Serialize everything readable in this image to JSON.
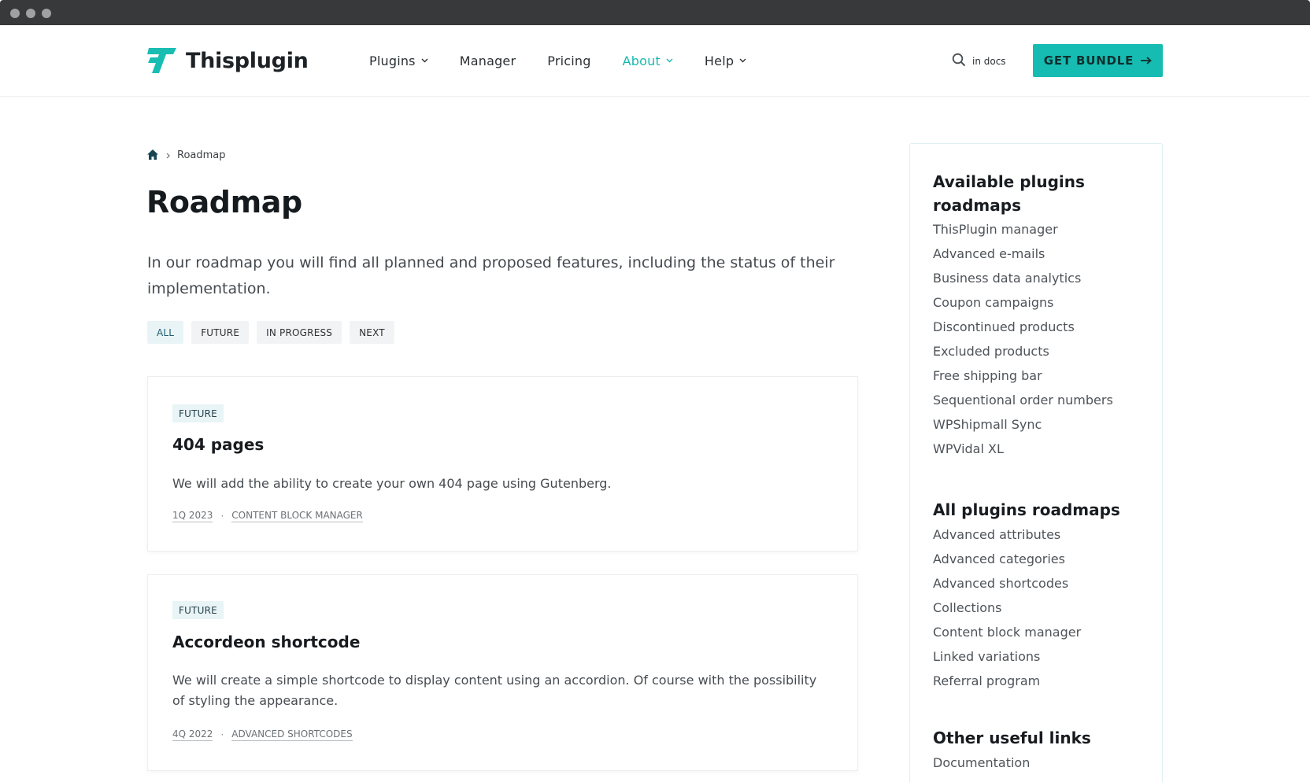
{
  "header": {
    "logo_text": "Thisplugin",
    "nav": [
      {
        "label": "Plugins",
        "dropdown": true,
        "active": false
      },
      {
        "label": "Manager",
        "dropdown": false,
        "active": false
      },
      {
        "label": "Pricing",
        "dropdown": false,
        "active": false
      },
      {
        "label": "About",
        "dropdown": true,
        "active": true
      },
      {
        "label": "Help",
        "dropdown": true,
        "active": false
      }
    ],
    "search_label": "in docs",
    "cta_label": "GET BUNDLE"
  },
  "breadcrumb": {
    "current": "Roadmap"
  },
  "main": {
    "title": "Roadmap",
    "intro": "In our roadmap you will find all planned and proposed features, including the status of their implementation.",
    "filters": [
      {
        "label": "ALL",
        "active": true
      },
      {
        "label": "FUTURE",
        "active": false
      },
      {
        "label": "IN PROGRESS",
        "active": false
      },
      {
        "label": "NEXT",
        "active": false
      }
    ],
    "cards": [
      {
        "badge": "FUTURE",
        "title": "404 pages",
        "description": "We will add the ability to create your own 404 page using Gutenberg.",
        "quarter": "1Q 2023",
        "plugin": "CONTENT BLOCK MANAGER"
      },
      {
        "badge": "FUTURE",
        "title": "Accordeon shortcode",
        "description": "We will create a simple shortcode to display content using an accordion. Of course with the possibility of styling the appearance.",
        "quarter": "4Q 2022",
        "plugin": "ADVANCED SHORTCODES"
      }
    ]
  },
  "sidebar": {
    "available_heading": "Available plugins roadmaps",
    "available": [
      "ThisPlugin manager",
      "Advanced e-mails",
      "Business data analytics",
      "Coupon campaigns",
      "Discontinued products",
      "Excluded products",
      "Free shipping bar",
      "Sequentional order numbers",
      "WPShipmall Sync",
      "WPVidal XL"
    ],
    "all_heading": "All plugins roadmaps",
    "all": [
      "Advanced attributes",
      "Advanced categories",
      "Advanced shortcodes",
      "Collections",
      "Content block manager",
      "Linked variations",
      "Referral program"
    ],
    "other_heading": "Other useful links",
    "other": [
      "Documentation"
    ]
  },
  "colors": {
    "accent": "#16bcb2",
    "chrome": "#38393b",
    "badge_bg": "#e9f4f7"
  },
  "icons": {
    "logo": "thisplugin-logo-icon",
    "search": "search-icon",
    "home": "home-icon",
    "chevron": "chevron-down-icon",
    "arrow": "arrow-right-icon"
  }
}
